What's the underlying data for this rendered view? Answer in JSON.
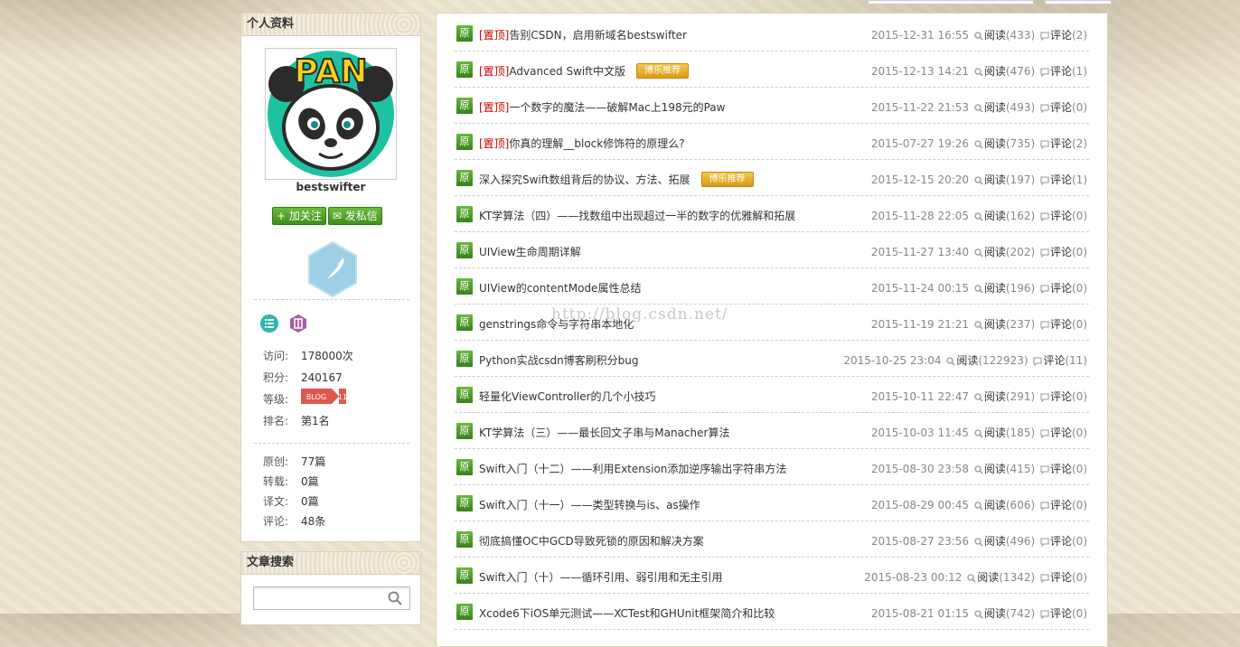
{
  "profile": {
    "header": "个人资料",
    "avatar_text": "PAN",
    "username": "bestswifter",
    "follow_label": "加关注",
    "message_label": "发私信",
    "stats": [
      {
        "key": "访问:",
        "value": "178000次"
      },
      {
        "key": "积分:",
        "value": "240167"
      },
      {
        "key": "等级:",
        "value": ""
      },
      {
        "key": "排名:",
        "value": "第1名"
      }
    ],
    "level_badge": "BLOG 11",
    "counts": [
      {
        "key": "原创:",
        "value": "77篇"
      },
      {
        "key": "转载:",
        "value": "0篇"
      },
      {
        "key": "译文:",
        "value": "0篇"
      },
      {
        "key": "评论:",
        "value": "48条"
      }
    ]
  },
  "search": {
    "header": "文章搜索",
    "placeholder": ""
  },
  "watermark": "http://blog.csdn.net/",
  "articles": [
    {
      "badge": "原",
      "pin": "[置顶]",
      "title": "告别CSDN，启用新域名bestswifter",
      "rec": "",
      "date": "2015-12-31 16:55",
      "read_label": "阅读",
      "reads": "(433)",
      "comment_label": "评论",
      "comments": "(2)"
    },
    {
      "badge": "原",
      "pin": "[置顶]",
      "title": "Advanced Swift中文版",
      "rec": "博乐推荐",
      "date": "2015-12-13 14:21",
      "read_label": "阅读",
      "reads": "(476)",
      "comment_label": "评论",
      "comments": "(1)"
    },
    {
      "badge": "原",
      "pin": "[置顶]",
      "title": "一个数字的魔法——破解Mac上198元的Paw",
      "rec": "",
      "date": "2015-11-22 21:53",
      "read_label": "阅读",
      "reads": "(493)",
      "comment_label": "评论",
      "comments": "(0)"
    },
    {
      "badge": "原",
      "pin": "[置顶]",
      "title": "你真的理解__block修饰符的原理么?",
      "rec": "",
      "date": "2015-07-27 19:26",
      "read_label": "阅读",
      "reads": "(735)",
      "comment_label": "评论",
      "comments": "(2)"
    },
    {
      "badge": "原",
      "pin": "",
      "title": "深入探究Swift数组背后的协议、方法、拓展",
      "rec": "博乐推荐",
      "date": "2015-12-15 20:20",
      "read_label": "阅读",
      "reads": "(197)",
      "comment_label": "评论",
      "comments": "(1)"
    },
    {
      "badge": "原",
      "pin": "",
      "title": "KT学算法（四）——找数组中出现超过一半的数字的优雅解和拓展",
      "rec": "",
      "date": "2015-11-28 22:05",
      "read_label": "阅读",
      "reads": "(162)",
      "comment_label": "评论",
      "comments": "(0)"
    },
    {
      "badge": "原",
      "pin": "",
      "title": "UIView生命周期详解",
      "rec": "",
      "date": "2015-11-27 13:40",
      "read_label": "阅读",
      "reads": "(202)",
      "comment_label": "评论",
      "comments": "(0)"
    },
    {
      "badge": "原",
      "pin": "",
      "title": "UIView的contentMode属性总结",
      "rec": "",
      "date": "2015-11-24 00:15",
      "read_label": "阅读",
      "reads": "(196)",
      "comment_label": "评论",
      "comments": "(0)"
    },
    {
      "badge": "原",
      "pin": "",
      "title": "genstrings命令与字符串本地化",
      "rec": "",
      "date": "2015-11-19 21:21",
      "read_label": "阅读",
      "reads": "(237)",
      "comment_label": "评论",
      "comments": "(0)"
    },
    {
      "badge": "原",
      "pin": "",
      "title": "Python实战csdn博客刷积分bug",
      "rec": "",
      "date": "2015-10-25 23:04",
      "read_label": "阅读",
      "reads": "(122923)",
      "comment_label": "评论",
      "comments": "(11)"
    },
    {
      "badge": "原",
      "pin": "",
      "title": "轻量化ViewController的几个小技巧",
      "rec": "",
      "date": "2015-10-11 22:47",
      "read_label": "阅读",
      "reads": "(291)",
      "comment_label": "评论",
      "comments": "(0)"
    },
    {
      "badge": "原",
      "pin": "",
      "title": "KT学算法（三）——最长回文子串与Manacher算法",
      "rec": "",
      "date": "2015-10-03 11:45",
      "read_label": "阅读",
      "reads": "(185)",
      "comment_label": "评论",
      "comments": "(0)"
    },
    {
      "badge": "原",
      "pin": "",
      "title": "Swift入门（十二）——利用Extension添加逆序输出字符串方法",
      "rec": "",
      "date": "2015-08-30 23:58",
      "read_label": "阅读",
      "reads": "(415)",
      "comment_label": "评论",
      "comments": "(0)"
    },
    {
      "badge": "原",
      "pin": "",
      "title": "Swift入门（十一）——类型转换与is、as操作",
      "rec": "",
      "date": "2015-08-29 00:45",
      "read_label": "阅读",
      "reads": "(606)",
      "comment_label": "评论",
      "comments": "(0)"
    },
    {
      "badge": "原",
      "pin": "",
      "title": "彻底搞懂OC中GCD导致死锁的原因和解决方案",
      "rec": "",
      "date": "2015-08-27 23:56",
      "read_label": "阅读",
      "reads": "(496)",
      "comment_label": "评论",
      "comments": "(0)"
    },
    {
      "badge": "原",
      "pin": "",
      "title": "Swift入门（十）——循环引用、弱引用和无主引用",
      "rec": "",
      "date": "2015-08-23 00:12",
      "read_label": "阅读",
      "reads": "(1342)",
      "comment_label": "评论",
      "comments": "(0)"
    },
    {
      "badge": "原",
      "pin": "",
      "title": "Xcode6下iOS单元测试——XCTest和GHUnit框架简介和比较",
      "rec": "",
      "date": "2015-08-21 01:15",
      "read_label": "阅读",
      "reads": "(742)",
      "comment_label": "评论",
      "comments": "(0)"
    }
  ],
  "colors": {
    "accent_green": "#3f8e1c",
    "pin_red": "#cc0000",
    "rec_gold": "#d99b17",
    "badge_blue": "#5ab0d8"
  }
}
